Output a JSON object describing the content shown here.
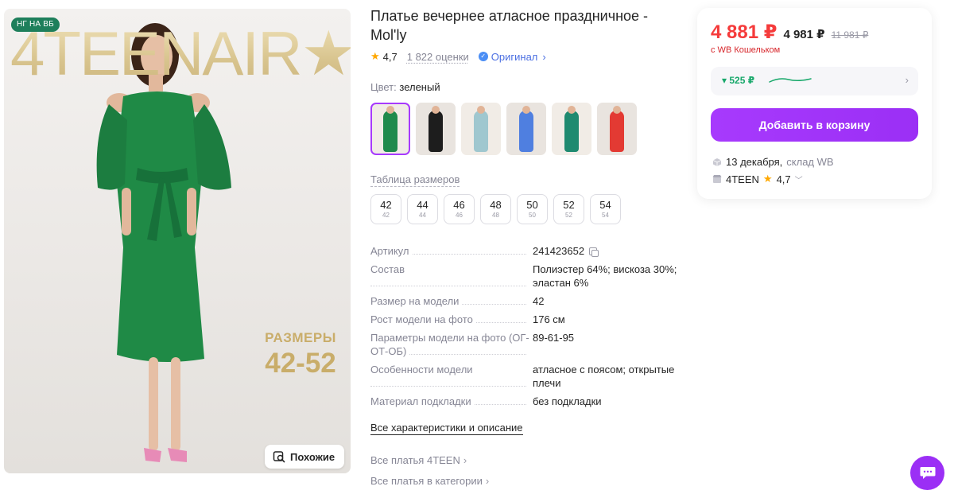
{
  "photo": {
    "badge": "НГ НА ВБ",
    "brand_banner": "4TEENAIR★",
    "promo_line1": "РАЗМЕРЫ",
    "promo_line2": "42-52",
    "similar_label": "Похожие"
  },
  "product": {
    "title": "Платье вечернее атласное праздничное - Mol'ly",
    "rating": "4,7",
    "reviews": "1 822 оценки",
    "original_label": "Оригинал",
    "color_label": "Цвет:",
    "color_value": "зеленый"
  },
  "thumbnails": [
    {
      "color": "#1f8a4c"
    },
    {
      "color": "#1d1d1d"
    },
    {
      "color": "#9fc7cf"
    },
    {
      "color": "#4f7fe0"
    },
    {
      "color": "#1f8a70"
    },
    {
      "color": "#e33a33"
    }
  ],
  "size_table_label": "Таблица размеров",
  "sizes": [
    {
      "size": "42",
      "ru": "42"
    },
    {
      "size": "44",
      "ru": "44"
    },
    {
      "size": "46",
      "ru": "46"
    },
    {
      "size": "48",
      "ru": "48"
    },
    {
      "size": "50",
      "ru": "50"
    },
    {
      "size": "52",
      "ru": "52"
    },
    {
      "size": "54",
      "ru": "54"
    }
  ],
  "specs": [
    {
      "key": "Артикул",
      "value": "241423652"
    },
    {
      "key": "Состав",
      "value": "Полиэстер 64%; вискоза 30%; эластан 6%"
    },
    {
      "key": "Размер на модели",
      "value": "42"
    },
    {
      "key": "Рост модели на фото",
      "value": "176 см"
    },
    {
      "key": "Параметры модели на фото (ОГ-ОТ-ОБ)",
      "value": "89-61-95"
    },
    {
      "key": "Особенности модели",
      "value": "атласное с поясом; открытые плечи"
    },
    {
      "key": "Материал подкладки",
      "value": "без подкладки"
    }
  ],
  "links": {
    "all_characteristics": "Все характеристики и описание",
    "all_brand_dresses": "Все платья 4TEEN",
    "all_category_dresses": "Все платья в категории"
  },
  "price_card": {
    "price_wallet": "4 881 ₽",
    "price": "4 981 ₽",
    "price_old": "11 981 ₽",
    "wallet_note": "с WB Кошельком",
    "bonus": "▾ 525 ₽",
    "add_to_cart": "Добавить в корзину",
    "delivery_date": "13 декабря,",
    "delivery_warehouse": "склад WB",
    "seller_name": "4TEEN",
    "seller_rating": "4,7"
  },
  "colors": {
    "accent": "#a73afd",
    "price_red": "#f53b3b",
    "bonus_green": "#17a86a",
    "link_blue": "#4b6fe2"
  }
}
